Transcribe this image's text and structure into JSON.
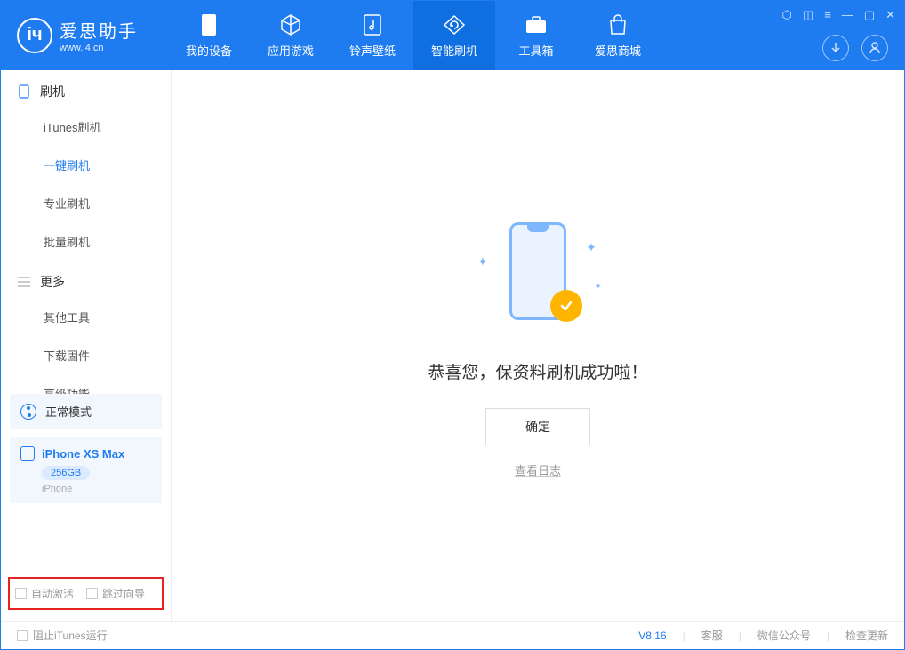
{
  "app": {
    "name_cn": "爱思助手",
    "url": "www.i4.cn"
  },
  "nav": {
    "tabs": [
      {
        "label": "我的设备"
      },
      {
        "label": "应用游戏"
      },
      {
        "label": "铃声壁纸"
      },
      {
        "label": "智能刷机"
      },
      {
        "label": "工具箱"
      },
      {
        "label": "爱思商城"
      }
    ]
  },
  "sidebar": {
    "section1": {
      "title": "刷机",
      "items": [
        {
          "label": "iTunes刷机"
        },
        {
          "label": "一键刷机"
        },
        {
          "label": "专业刷机"
        },
        {
          "label": "批量刷机"
        }
      ]
    },
    "section2": {
      "title": "更多",
      "items": [
        {
          "label": "其他工具"
        },
        {
          "label": "下载固件"
        },
        {
          "label": "高级功能"
        }
      ]
    },
    "mode_label": "正常模式",
    "device": {
      "name": "iPhone XS Max",
      "capacity": "256GB",
      "type": "iPhone"
    },
    "checks": {
      "auto_activate": "自动激活",
      "skip_guide": "跳过向导"
    }
  },
  "main": {
    "success_text": "恭喜您，保资料刷机成功啦！",
    "ok_label": "确定",
    "log_link": "查看日志"
  },
  "footer": {
    "block_itunes": "阻止iTunes运行",
    "version": "V8.16",
    "links": {
      "support": "客服",
      "wechat": "微信公众号",
      "update": "检查更新"
    }
  }
}
